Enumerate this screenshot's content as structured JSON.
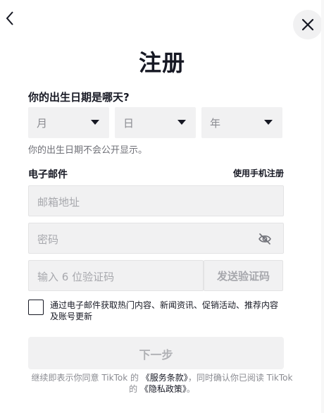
{
  "title": "注册",
  "dob": {
    "label": "你的出生日期是哪天?",
    "month_placeholder": "月",
    "day_placeholder": "日",
    "year_placeholder": "年",
    "hint": "你的出生日期不会公开显示。"
  },
  "email": {
    "label": "电子邮件",
    "phone_link": "使用手机注册",
    "email_placeholder": "邮箱地址",
    "password_placeholder": "密码",
    "code_placeholder": "输入 6 位验证码",
    "send_code": "发送验证码"
  },
  "consent_text": "通过电子邮件获取热门内容、新闻资讯、促销活动、推荐内容及账号更新",
  "next_button": "下一步",
  "footer": {
    "part1": "继续即表示你同意 TikTok 的 ",
    "terms": "《服务条款》",
    "part2": "，同时确认你已阅读 TikTok 的 ",
    "privacy": "《隐私政策》",
    "part3": "。"
  },
  "icons": [
    "back-arrow-icon",
    "close-icon",
    "caret-down-icon",
    "eye-off-icon"
  ],
  "colors": {
    "text": "#161823",
    "field_bg": "#f1f1f2",
    "muted": "#8a8b91"
  }
}
